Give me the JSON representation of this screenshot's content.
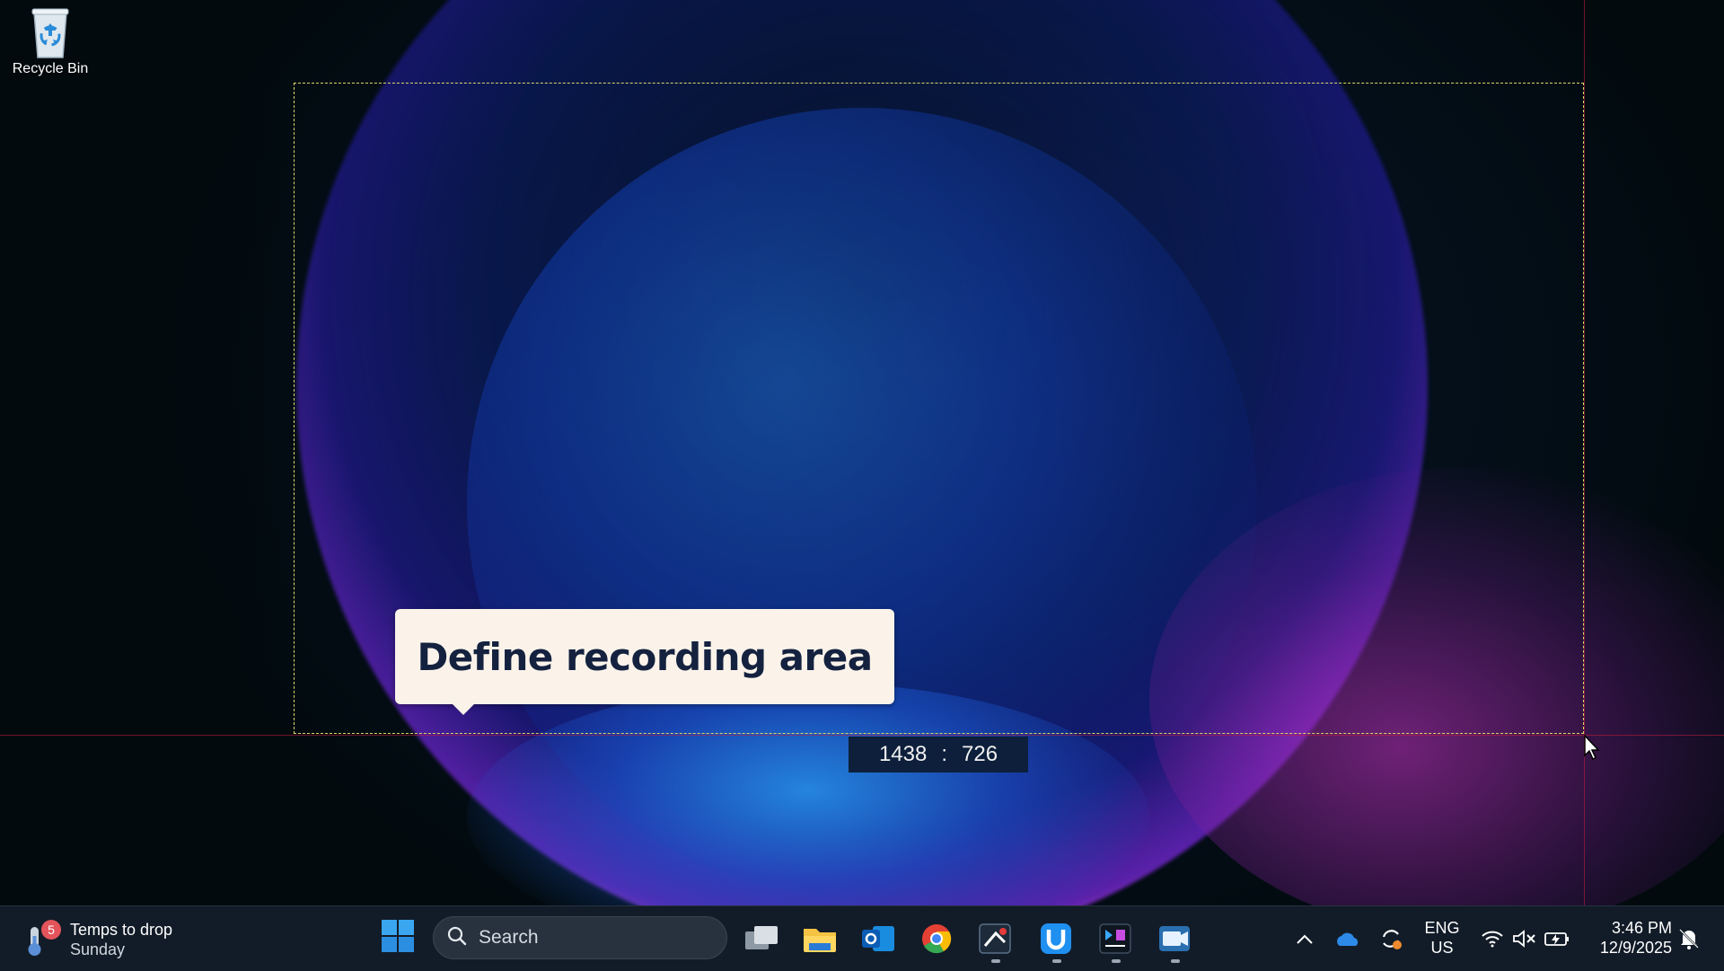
{
  "desktop": {
    "icons": [
      {
        "label": "Recycle Bin",
        "icon": "recycle-bin-icon"
      }
    ]
  },
  "recording_overlay": {
    "callout": "Define recording area",
    "width_readout": "1438",
    "separator": ":",
    "height_readout": "726",
    "selection_border_color": "#d8d86a",
    "guide_color": "#c81e3c"
  },
  "taskbar": {
    "weather": {
      "badge": "5",
      "title": "Temps to drop",
      "subtitle": "Sunday",
      "icon": "thermometer-icon"
    },
    "start_icon": "windows-start-icon",
    "search": {
      "placeholder": "Search",
      "icon": "search-icon"
    },
    "apps": [
      {
        "name": "Task View",
        "icon": "task-view-icon",
        "running": false
      },
      {
        "name": "File Explorer",
        "icon": "file-explorer-icon",
        "running": false
      },
      {
        "name": "Outlook",
        "icon": "outlook-icon",
        "running": false
      },
      {
        "name": "Chrome",
        "icon": "chrome-icon",
        "running": false
      },
      {
        "name": "Screen Recorder",
        "icon": "screen-recorder-icon",
        "running": true
      },
      {
        "name": "U App",
        "icon": "u-app-icon",
        "running": true
      },
      {
        "name": "Video Editor",
        "icon": "video-editor-icon",
        "running": true
      },
      {
        "name": "Camera App",
        "icon": "camera-app-icon",
        "running": true
      }
    ],
    "tray": {
      "language_primary": "ENG",
      "language_secondary": "US",
      "time": "3:46 PM",
      "date": "12/9/2025",
      "icons": [
        "chevron-up-icon",
        "onedrive-icon",
        "sync-icon",
        "wifi-icon",
        "volume-muted-icon",
        "battery-icon",
        "notification-icon"
      ]
    }
  }
}
